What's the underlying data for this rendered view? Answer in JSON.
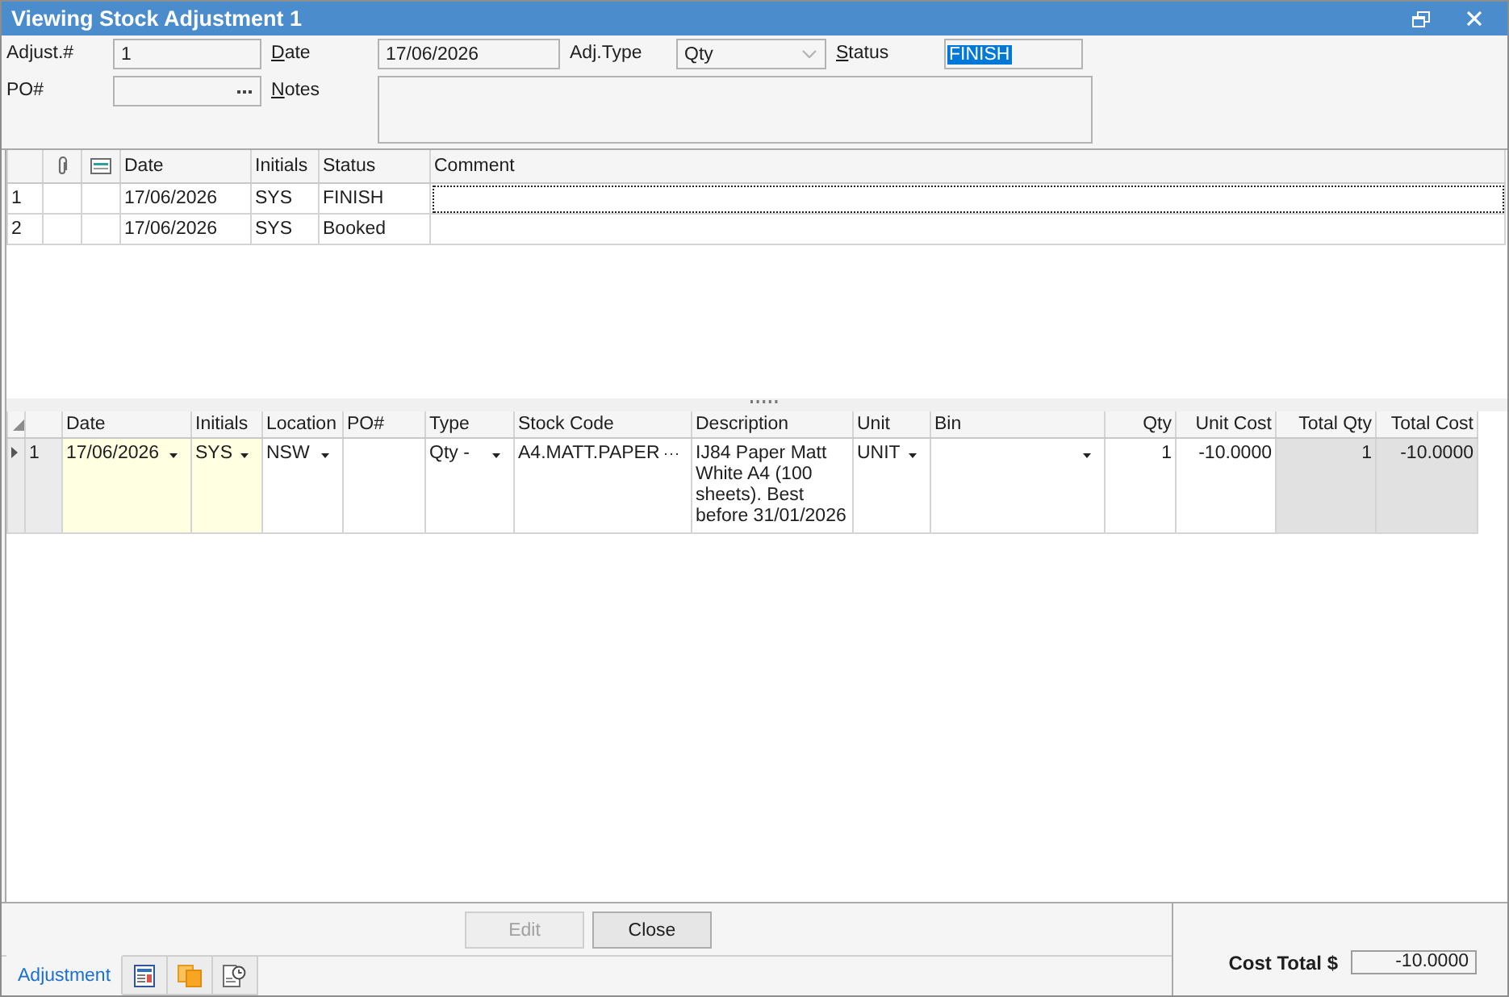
{
  "window": {
    "title": "Viewing Stock Adjustment 1"
  },
  "header": {
    "fields": [
      {
        "label": "Adjust.#",
        "kind": "text",
        "value": "1",
        "mnemonic": false,
        "text_selected": false
      },
      {
        "label": "Date",
        "kind": "text",
        "value": "17/06/2026",
        "mnemonic": true,
        "text_selected": false
      },
      {
        "label": "Adj.Type",
        "kind": "dropdown",
        "value": "Qty",
        "mnemonic": false,
        "text_selected": false
      },
      {
        "label": "Status",
        "kind": "text",
        "value": "FINISH",
        "mnemonic": true,
        "text_selected": true
      },
      {
        "label": "PO#",
        "kind": "lookup",
        "mnemonic": false,
        "text_selected": false
      },
      {
        "label": "Notes",
        "kind": "memo",
        "mnemonic": true,
        "text_selected": false
      }
    ]
  },
  "history": {
    "columns": [
      "Date",
      "Initials",
      "Status",
      "Comment"
    ],
    "rows": [
      {
        "number": "1",
        "cells": [
          "17/06/2026",
          "SYS",
          "FINISH"
        ],
        "focused": true
      },
      {
        "number": "2",
        "cells": [
          "17/06/2026",
          "SYS",
          "Booked"
        ],
        "focused": false
      }
    ]
  },
  "lines": {
    "columns": [
      {
        "label": "Date",
        "kind": "dropdown",
        "required": true,
        "read_only": false
      },
      {
        "label": "Initials",
        "kind": "dropdown",
        "required": true,
        "read_only": false
      },
      {
        "label": "Location",
        "kind": "dropdown",
        "required": false,
        "read_only": false
      },
      {
        "label": "PO#",
        "kind": "text",
        "required": false,
        "read_only": false
      },
      {
        "label": "Type",
        "kind": "dropdown",
        "required": false,
        "read_only": false
      },
      {
        "label": "Stock Code",
        "kind": "lookup",
        "required": false,
        "read_only": false
      },
      {
        "label": "Description",
        "kind": "text",
        "required": false,
        "read_only": false
      },
      {
        "label": "Unit",
        "kind": "dropdown",
        "required": false,
        "read_only": false
      },
      {
        "label": "Bin",
        "kind": "dropdown",
        "required": false,
        "read_only": false
      },
      {
        "label": "Qty",
        "kind": "number",
        "required": false,
        "read_only": false
      },
      {
        "label": "Unit Cost",
        "kind": "number",
        "required": false,
        "read_only": false
      },
      {
        "label": "Total Qty",
        "kind": "number",
        "required": false,
        "read_only": true
      },
      {
        "label": "Total Cost",
        "kind": "number",
        "required": false,
        "read_only": true
      }
    ],
    "rows": [
      {
        "number": "1",
        "current": true,
        "cells": [
          "17/06/2026",
          "SYS",
          "NSW",
          null,
          "Qty -",
          "A4.MATT.PAPER",
          "IJ84 Paper Matt White A4 (100 sheets). Best before 31/01/2026",
          "UNIT",
          null,
          "1",
          "-10.0000",
          "1",
          "-10.0000"
        ]
      }
    ]
  },
  "footer": {
    "buttons": [
      {
        "label": "Edit",
        "disabled": true
      },
      {
        "label": "Close",
        "disabled": false
      }
    ],
    "tabs": [
      {
        "kind": "text",
        "label": "Adjustment",
        "selected": true
      },
      {
        "kind": "icon",
        "selected": false
      },
      {
        "kind": "icon",
        "selected": false
      },
      {
        "kind": "icon",
        "selected": false
      }
    ],
    "total": {
      "label": "Cost Total $",
      "value": "-10.0000"
    }
  }
}
